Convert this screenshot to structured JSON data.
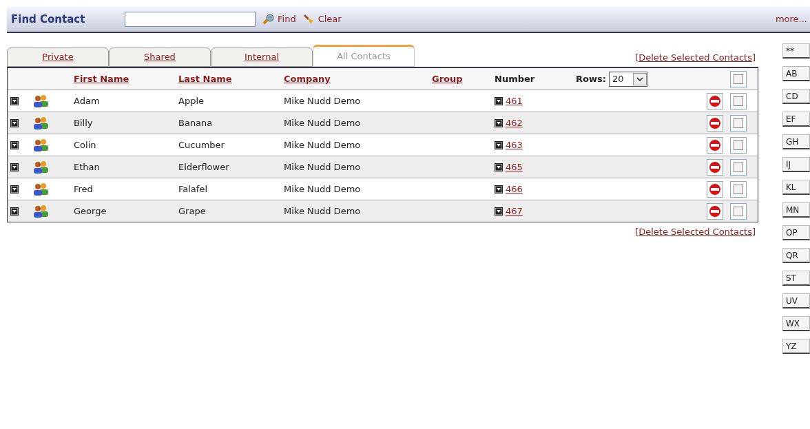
{
  "search_bar": {
    "title": "Find Contact",
    "find": "Find",
    "clear": "Clear",
    "more": "more..."
  },
  "tabs": [
    {
      "label": "Private",
      "selected": false
    },
    {
      "label": "Shared",
      "selected": false
    },
    {
      "label": "Internal",
      "selected": false
    },
    {
      "label": "All Contacts",
      "selected": true
    }
  ],
  "delete_link_top": "[Delete Selected Contacts]",
  "delete_link_bottom": "[Delete Selected Contacts]",
  "table": {
    "columns": [
      "First Name",
      "Last Name",
      "Company",
      "Group",
      "Number"
    ],
    "rows_label": "Rows:",
    "rows_value": "20",
    "select_all_checked": false,
    "rows": [
      {
        "first": "Adam",
        "last": "Apple",
        "company": "Mike Nudd Demo",
        "number": "461",
        "checked": false
      },
      {
        "first": "Billy",
        "last": "Banana",
        "company": "Mike Nudd Demo",
        "number": "462",
        "checked": false
      },
      {
        "first": "Colin",
        "last": "Cucumber",
        "company": "Mike Nudd Demo",
        "number": "463",
        "checked": false
      },
      {
        "first": "Ethan",
        "last": "Elderflower",
        "company": "Mike Nudd Demo",
        "number": "465",
        "checked": false
      },
      {
        "first": "Fred",
        "last": "Falafel",
        "company": "Mike Nudd Demo",
        "number": "466",
        "checked": false
      },
      {
        "first": "George",
        "last": "Grape",
        "company": "Mike Nudd Demo",
        "number": "467",
        "checked": false
      }
    ]
  },
  "letter_buttons": [
    "**",
    "AB",
    "CD",
    "EF",
    "GH",
    "IJ",
    "KL",
    "MN",
    "OP",
    "QR",
    "ST",
    "UV",
    "WX",
    "YZ"
  ]
}
